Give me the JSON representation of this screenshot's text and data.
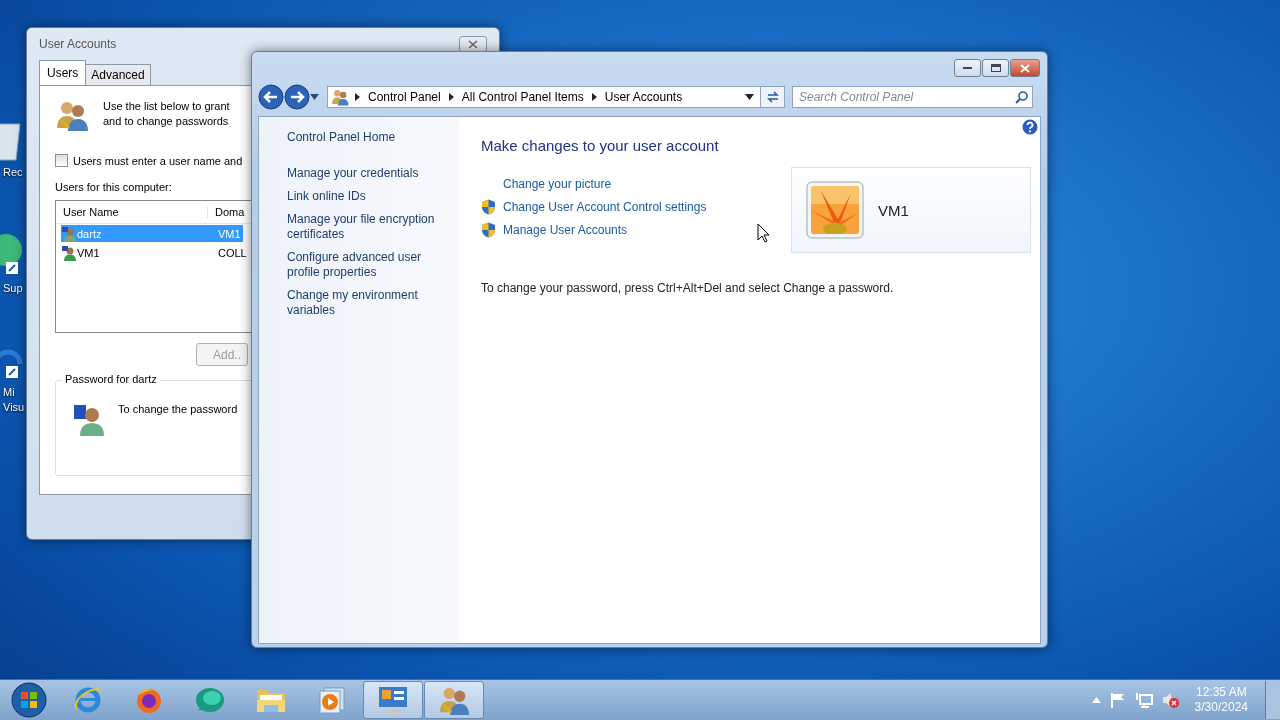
{
  "desktop_icons": [
    {
      "kind": "recycle",
      "lines": [
        "Rec"
      ]
    },
    {
      "kind": "globe",
      "lines": [
        "Sup"
      ]
    },
    {
      "kind": "studio",
      "lines": [
        "Mi",
        "Visu"
      ]
    }
  ],
  "back_window": {
    "title": "User Accounts",
    "tabs": [
      {
        "label": "Users",
        "selected": true
      },
      {
        "label": "Advanced",
        "selected": false
      }
    ],
    "intro": [
      "Use the list below to grant",
      "and to change passwords"
    ],
    "login_checkbox": {
      "label": "Users must enter a user name and",
      "checked": false
    },
    "users_label": "Users for this computer:",
    "columns": [
      "User Name",
      "Doma"
    ],
    "rows": [
      {
        "cells": [
          "dartz",
          "VM1"
        ],
        "selected": true
      },
      {
        "cells": [
          "VM1",
          "COLL"
        ],
        "selected": false
      }
    ],
    "add_button": {
      "label": "Add..",
      "disabled": true
    },
    "password_group": {
      "title": "Password for dartz",
      "text": "To change the password"
    }
  },
  "control_panel": {
    "breadcrumb": [
      "Control Panel",
      "All Control Panel Items",
      "User Accounts"
    ],
    "search": {
      "placeholder": "Search Control Panel"
    },
    "sidebar": {
      "home": "Control Panel Home",
      "tasks": [
        "Manage your credentials",
        "Link online IDs",
        "Manage your file encryption certificates",
        "Configure advanced user profile properties",
        "Change my environment variables"
      ]
    },
    "heading": "Make changes to your user account",
    "links": [
      {
        "label": "Change your picture",
        "kind": "plain"
      },
      {
        "label": "Change User Account Control settings",
        "kind": "shield"
      },
      {
        "label": "Manage User Accounts",
        "kind": "shield"
      }
    ],
    "account": {
      "name": "VM1"
    },
    "note": "To change your password, press Ctrl+Alt+Del and select Change a password."
  },
  "taskbar": {
    "apps": [
      {
        "kind": "ie",
        "active": false
      },
      {
        "kind": "firefox",
        "active": false
      },
      {
        "kind": "chat",
        "active": false
      },
      {
        "kind": "folder",
        "active": false
      },
      {
        "kind": "media",
        "active": false
      },
      {
        "kind": "control",
        "active": true
      },
      {
        "kind": "users",
        "active": true
      }
    ],
    "clock": {
      "time": "12:35 AM",
      "date": "3/30/2024"
    }
  }
}
